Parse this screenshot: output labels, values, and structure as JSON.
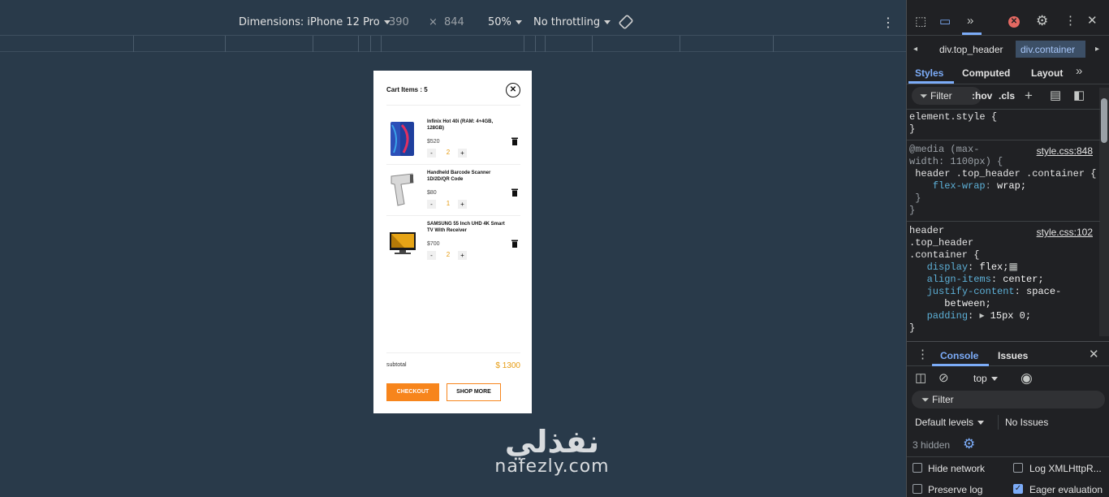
{
  "toolbar": {
    "dimensions_label": "Dimensions: iPhone 12 Pro",
    "width": "390",
    "times": "×",
    "height": "844",
    "zoom": "50%",
    "throttling": "No throttling"
  },
  "cart": {
    "title": "Cart Items : 5",
    "items": [
      {
        "name": "Infinix Hot 40i (RAM: 4+4GB, 128GB)",
        "price": "$520",
        "qty": "2",
        "minus": "-",
        "plus": "+"
      },
      {
        "name": "Handheld Barcode Scanner 1D/2D/QR Code",
        "price": "$80",
        "qty": "1",
        "minus": "-",
        "plus": "+"
      },
      {
        "name": "SAMSUNG 55 Inch UHD 4K Smart TV With Receiver",
        "price": "$700",
        "qty": "2",
        "minus": "-",
        "plus": "+"
      }
    ],
    "subtotal_label": "subtotal",
    "subtotal_value": "$ 1300",
    "checkout_label": "CHECKOUT",
    "shop_more_label": "SHOP MORE"
  },
  "watermark": {
    "arabic": "نفذلي",
    "latin": "nafezly.com"
  },
  "devtools": {
    "breadcrumb": [
      "div.top_header",
      "div.container"
    ],
    "style_tabs": [
      "Styles",
      "Computed",
      "Layout"
    ],
    "filter_placeholder": "Filter",
    "hov": ":hov",
    "cls": ".cls",
    "rules": {
      "element_style": "element.style {",
      "close": "}",
      "media_line1": "@media (max-",
      "media_line2": "width: 1100px) {",
      "media_sel": " header .top_header .container {",
      "media_prop": "flex-wrap",
      "media_val": "wrap;",
      "media_close1": " }",
      "media_close2": "}",
      "link1": "style.css:848",
      "sel1": "header",
      "sel2": ".top_header",
      "sel3": ".container {",
      "link2": "style.css:102",
      "p1": "display",
      "v1": "flex;",
      "p2": "align-items",
      "v2": "center;",
      "p3": "justify-content",
      "v3a": "space-",
      "v3b": "between;",
      "p4": "padding",
      "v4": "15px 0;"
    },
    "console_tabs": [
      "Console",
      "Issues"
    ],
    "context": "top",
    "console_filter": "Filter",
    "levels": "Default levels",
    "no_issues": "No Issues",
    "hidden": "3 hidden",
    "options": [
      "Hide network",
      "Log XMLHttpR...",
      "Preserve log",
      "Eager evaluation"
    ],
    "accent": "#7cacf8"
  }
}
